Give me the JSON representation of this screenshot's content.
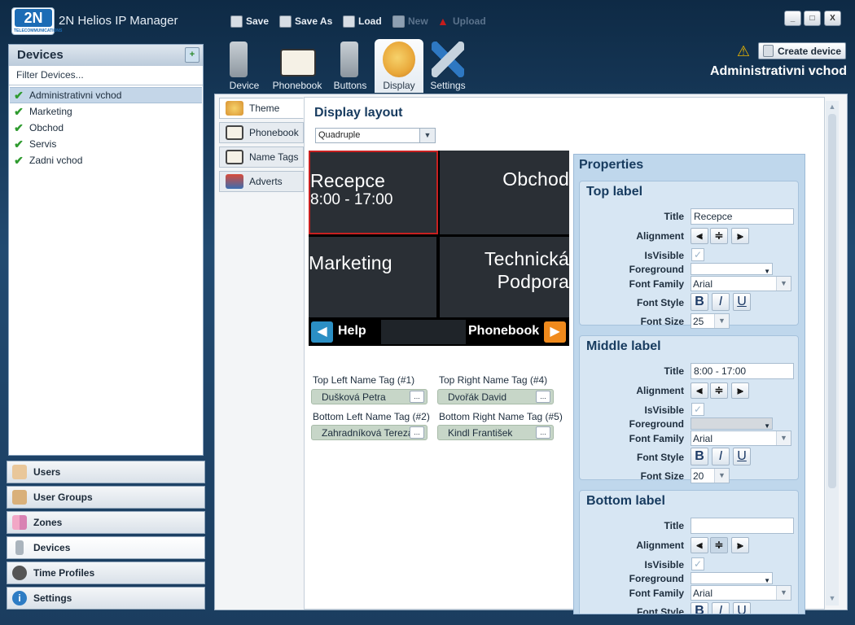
{
  "app": {
    "title": "2N Helios IP Manager",
    "logo_text": "2N",
    "logo_sub": "TELECOMMUNICATIONS"
  },
  "toolbar": {
    "save": "Save",
    "save_as": "Save As",
    "load": "Load",
    "new": "New",
    "upload": "Upload"
  },
  "window_controls": {
    "min": "_",
    "max": "□",
    "close": "X"
  },
  "devices_panel": {
    "title": "Devices",
    "filter_placeholder": "Filter Devices...",
    "items": [
      {
        "label": "Administrativni vchod",
        "selected": true
      },
      {
        "label": "Marketing"
      },
      {
        "label": "Obchod"
      },
      {
        "label": "Servis"
      },
      {
        "label": "Zadni vchod"
      }
    ]
  },
  "nav": [
    {
      "label": "Users",
      "icon": "user-icon"
    },
    {
      "label": "User Groups",
      "icon": "user-groups-icon"
    },
    {
      "label": "Zones",
      "icon": "zones-icon"
    },
    {
      "label": "Devices",
      "icon": "device-icon",
      "active": true
    },
    {
      "label": "Time Profiles",
      "icon": "clock-icon"
    },
    {
      "label": "Settings",
      "icon": "info-icon"
    }
  ],
  "top_tabs": [
    {
      "label": "Device"
    },
    {
      "label": "Phonebook"
    },
    {
      "label": "Buttons"
    },
    {
      "label": "Display",
      "active": true
    },
    {
      "label": "Settings"
    }
  ],
  "header": {
    "create_device": "Create device",
    "device_name": "Administrativni vchod"
  },
  "sub_tabs": [
    {
      "label": "Theme",
      "active": true
    },
    {
      "label": "Phonebook"
    },
    {
      "label": "Name Tags"
    },
    {
      "label": "Adverts"
    }
  ],
  "display_layout": {
    "title": "Display layout",
    "layout_value": "Quadruple",
    "cells": {
      "top_left": {
        "name": "Recepce",
        "sub": "8:00 - 17:00"
      },
      "top_right": {
        "name": "Obchod"
      },
      "bottom_left": {
        "name": "Marketing"
      },
      "bottom_right": {
        "name": "Technická",
        "name2": "Podpora"
      }
    },
    "bar": {
      "help": "Help",
      "phonebook": "Phonebook"
    }
  },
  "name_tags": [
    {
      "label": "Top Left Name Tag (#1)",
      "value": "Dušková Petra"
    },
    {
      "label": "Top Right Name Tag (#4)",
      "value": "Dvořák David"
    },
    {
      "label": "Bottom Left Name Tag (#2)",
      "value": "Zahradníková Tereza"
    },
    {
      "label": "Bottom Right Name Tag (#5)",
      "value": "Kindl František"
    }
  ],
  "properties": {
    "title": "Properties",
    "labels": {
      "title": "Title",
      "alignment": "Alignment",
      "isvisible": "IsVisible",
      "foreground": "Foreground",
      "font_family": "Font Family",
      "font_style": "Font Style",
      "font_size": "Font Size"
    },
    "groups": [
      {
        "name": "Top label",
        "title_value": "Recepce",
        "font_family": "Arial",
        "font_size": "25"
      },
      {
        "name": "Middle label",
        "title_value": "8:00 - 17:00",
        "font_family": "Arial",
        "font_size": "20"
      },
      {
        "name": "Bottom label",
        "title_value": "",
        "font_family": "Arial",
        "font_size": ""
      }
    ],
    "style_buttons": {
      "bold": "B",
      "italic": "I",
      "underline": "U"
    }
  },
  "colors": {
    "accent": "#1c6cb5",
    "selected_cell_border": "#c82020",
    "nametag_bg": "#c7d6c8",
    "help_btn": "#2b8fc4",
    "phonebook_btn": "#f08a1c"
  }
}
